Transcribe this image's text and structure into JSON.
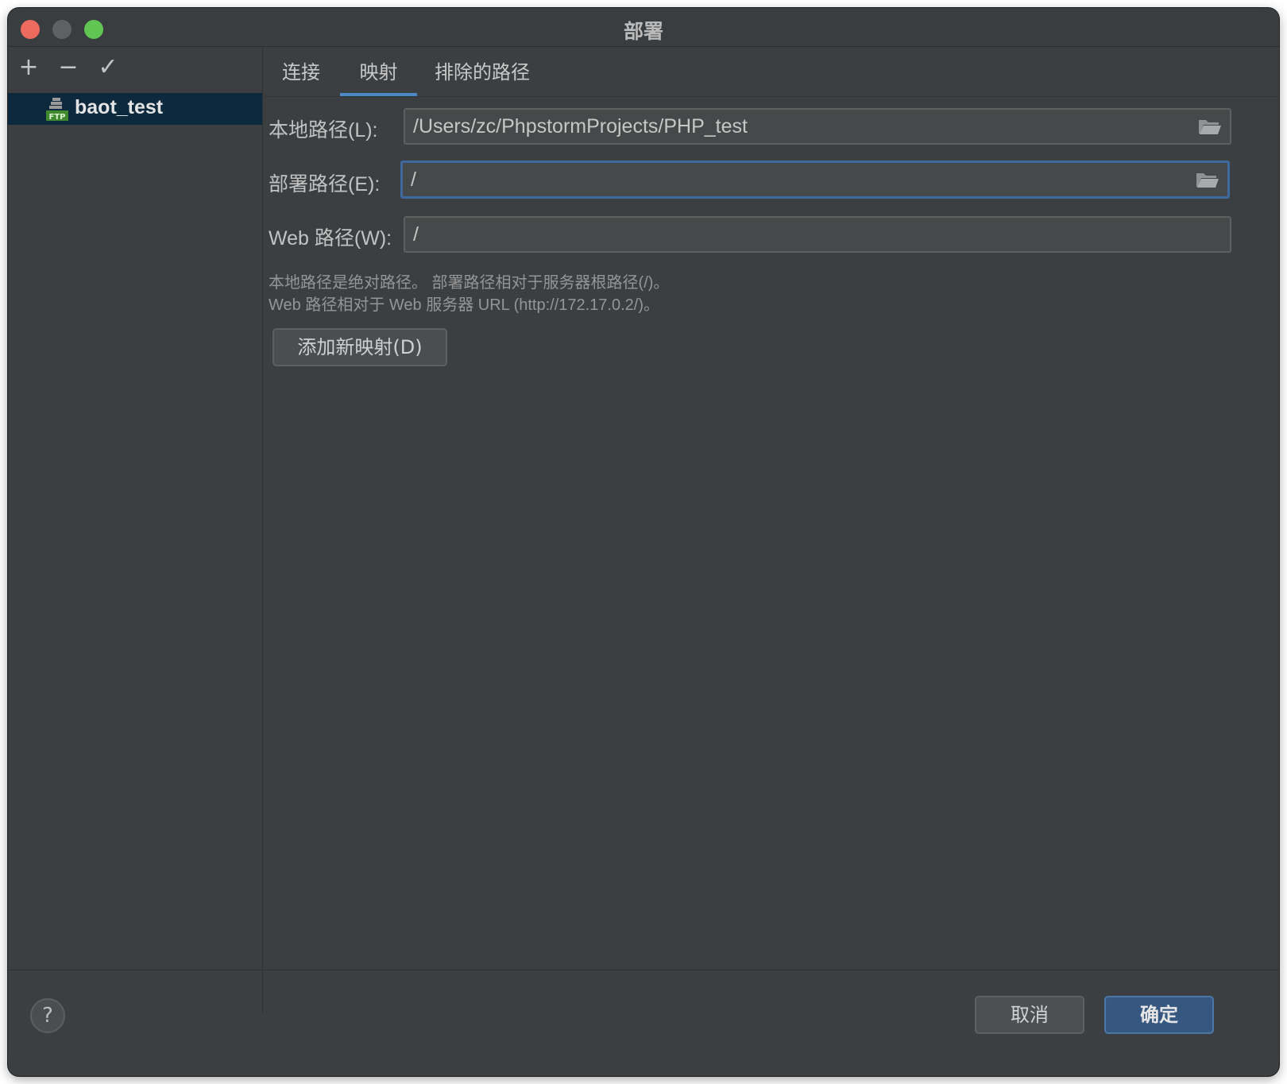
{
  "window": {
    "title": "部署"
  },
  "sidebar": {
    "toolbar": {
      "add": "+",
      "remove": "−",
      "apply": "✓"
    },
    "servers": [
      {
        "label": "baot_test",
        "icon": "ftp-server-icon"
      }
    ]
  },
  "tabs": [
    {
      "label": "连接"
    },
    {
      "label": "映射",
      "active": true
    },
    {
      "label": "排除的路径"
    }
  ],
  "mapping": {
    "local_label": "本地路径(L):",
    "local_value": "/Users/zc/PhpstormProjects/PHP_test",
    "deploy_label": "部署路径(E):",
    "deploy_value": "/",
    "web_label": "Web 路径(W):",
    "web_value": "/",
    "hint_line1": "本地路径是绝对路径。 部署路径相对于服务器根路径(/)。",
    "hint_line2": "Web 路径相对于 Web 服务器 URL (http://172.17.0.2/)。",
    "add_button": "添加新映射(D)"
  },
  "footer": {
    "help": "?",
    "cancel": "取消",
    "ok": "确定"
  },
  "colors": {
    "accent": "#4a88c7",
    "ok_button": "#365880",
    "selection": "#0d293e"
  }
}
